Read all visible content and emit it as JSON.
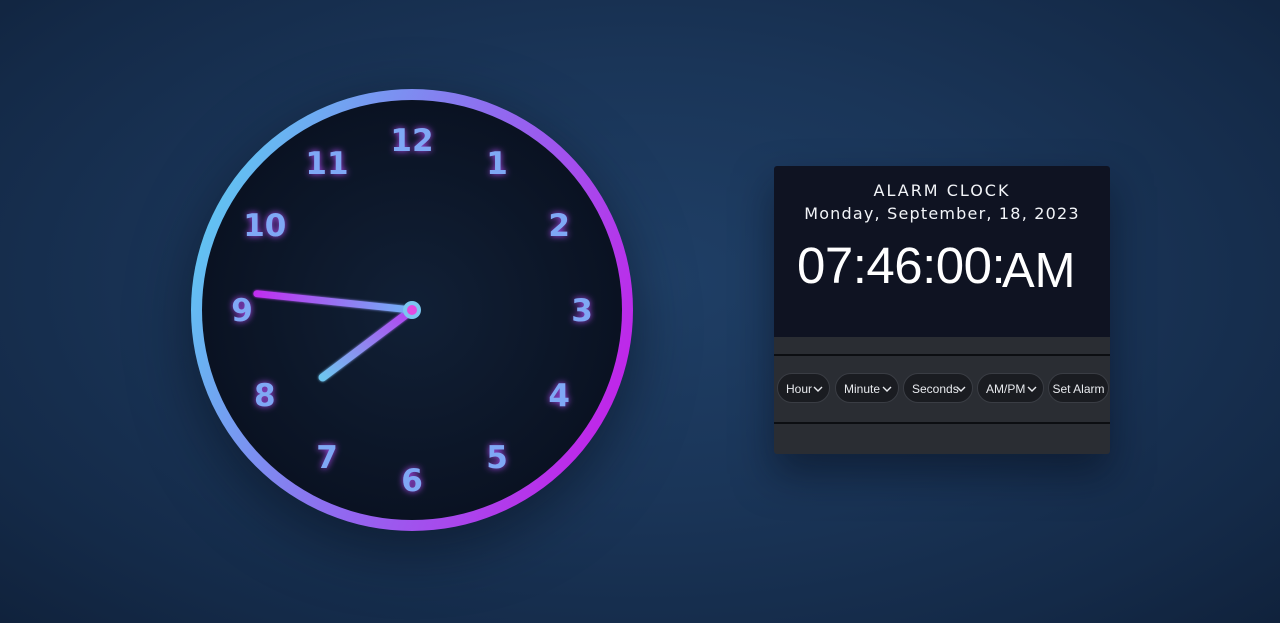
{
  "analog_clock": {
    "numerals": [
      "12",
      "1",
      "2",
      "3",
      "4",
      "5",
      "6",
      "7",
      "8",
      "9",
      "10",
      "11"
    ],
    "time": {
      "hour": 7,
      "minute": 46,
      "second": 0
    },
    "colors": {
      "ring_start": "#5ec8f2",
      "ring_end": "#c321e8",
      "face": "#0c1628",
      "numeral": "#7fa8f5",
      "numeral_glow": "#b94dff",
      "center_dot": "#e24be0"
    }
  },
  "alarm": {
    "title": "ALARM CLOCK",
    "date": "Monday, September, 18, 2023",
    "time": "07:46:00:",
    "ampm": "AM",
    "controls": {
      "hour": {
        "label": "Hour",
        "icon": "chevron-down-icon"
      },
      "minute": {
        "label": "Minute",
        "icon": "chevron-down-icon"
      },
      "seconds": {
        "label": "Seconds",
        "icon": "chevron-down-icon"
      },
      "ampm": {
        "label": "AM/PM",
        "icon": "chevron-down-icon"
      },
      "set_alarm": {
        "label": "Set Alarm"
      }
    }
  }
}
